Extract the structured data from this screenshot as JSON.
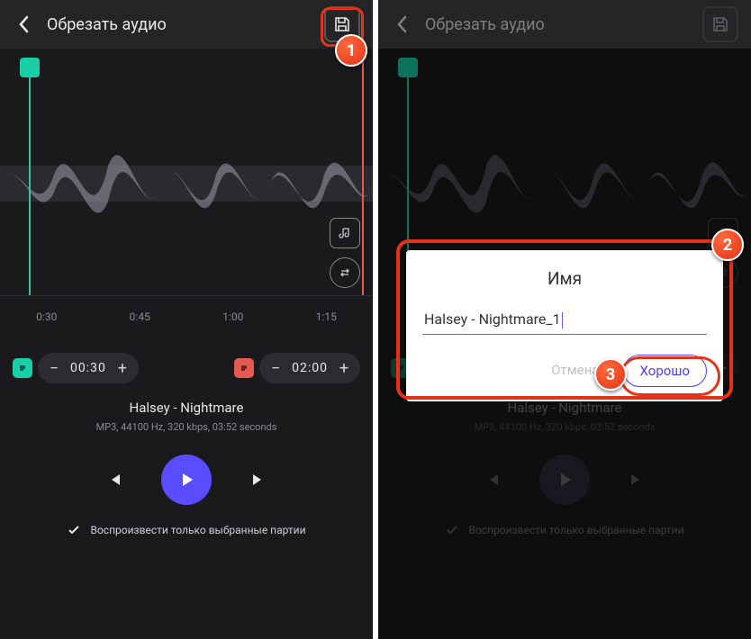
{
  "header": {
    "title": "Обрезать аудио"
  },
  "timeline": {
    "t1": "0:30",
    "t2": "0:45",
    "t3": "1:00",
    "t4": "1:15"
  },
  "times": {
    "start": "00:30",
    "end": "02:00"
  },
  "track": {
    "title": "Halsey - Nightmare",
    "meta": "MP3, 44100 Hz, 320 kbps, 03:52 seconds"
  },
  "checkbox": {
    "label": "Воспроизвести только выбранные партии"
  },
  "dialog": {
    "title": "Имя",
    "value": "Halsey - Nightmare_1",
    "cancel": "Отмена",
    "ok": "Хорошо"
  },
  "callouts": {
    "one": "1",
    "two": "2",
    "three": "3"
  },
  "symbols": {
    "minus": "−",
    "plus": "+"
  }
}
